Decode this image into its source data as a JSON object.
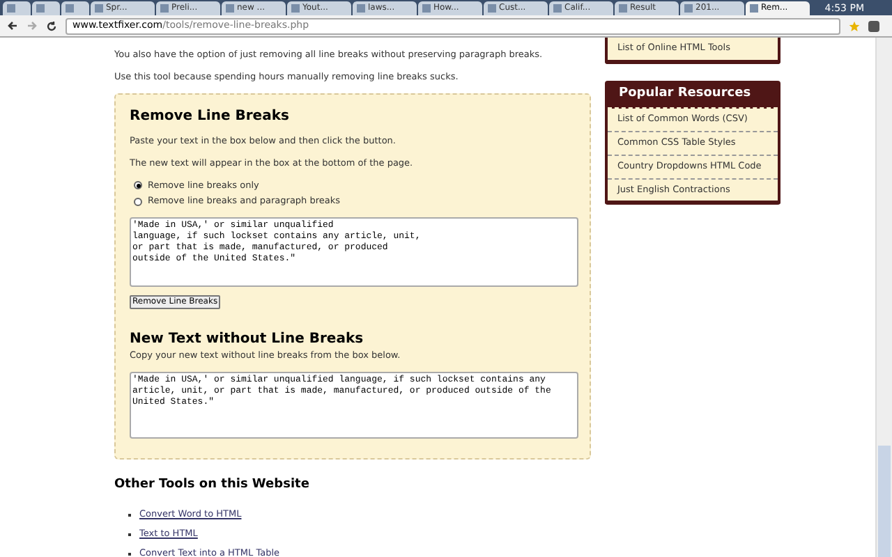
{
  "browser": {
    "tabs": [
      {
        "selected": false
      },
      {
        "selected": false
      },
      {
        "selected": false
      },
      {
        "label": "Spr...",
        "selected": false
      },
      {
        "label": "Preli...",
        "selected": false
      },
      {
        "label": "new ...",
        "selected": false
      },
      {
        "label": "Yout...",
        "selected": false
      },
      {
        "label": "laws...",
        "selected": false
      },
      {
        "label": "How...",
        "selected": false
      },
      {
        "label": "Cust...",
        "selected": false
      },
      {
        "label": "Calif...",
        "selected": false
      },
      {
        "label": "Result",
        "selected": false
      },
      {
        "label": "201...",
        "selected": false
      },
      {
        "label": "Rem...",
        "selected": true
      }
    ],
    "clock": "4:53 PM",
    "address": {
      "host": "www.textfixer.com",
      "path": "/tools/remove-line-breaks.php"
    }
  },
  "intro": [
    "You also have the option of just removing all line breaks without preserving paragraph breaks.",
    "Use this tool because spending hours manually removing line breaks sucks."
  ],
  "tool": {
    "title": "Remove Line Breaks",
    "instructions": [
      "Paste your text in the box below and then click the button.",
      "The new text will appear in the box at the bottom of the page."
    ],
    "options": [
      {
        "label": "Remove line breaks only",
        "selected": true
      },
      {
        "label": "Remove line breaks and paragraph breaks",
        "selected": false
      }
    ],
    "input": "'Made in USA,' or similar unqualified\nlanguage, if such lockset contains any article, unit,\nor part that is made, manufactured, or produced\noutside of the United States.\"",
    "button": "Remove Line Breaks",
    "output_title": "New Text without Line Breaks",
    "output_hint": "Copy your new text without line breaks from the box below.",
    "output": "'Made in USA,' or similar unqualified language, if such lockset contains any article, unit, or part that is made, manufactured, or produced outside of the United States.\""
  },
  "other_tools": {
    "title": "Other Tools on this Website",
    "links": [
      "Convert Word to HTML",
      "Text to HTML",
      "Convert Text into a HTML Table"
    ]
  },
  "sidebar": {
    "top_links": [
      "List of Online HTML Tools"
    ],
    "popular": {
      "title": "Popular Resources",
      "links": [
        "List of Common Words (CSV)",
        "Common CSS Table Styles",
        "Country Dropdowns HTML Code",
        "Just English Contractions"
      ]
    }
  }
}
